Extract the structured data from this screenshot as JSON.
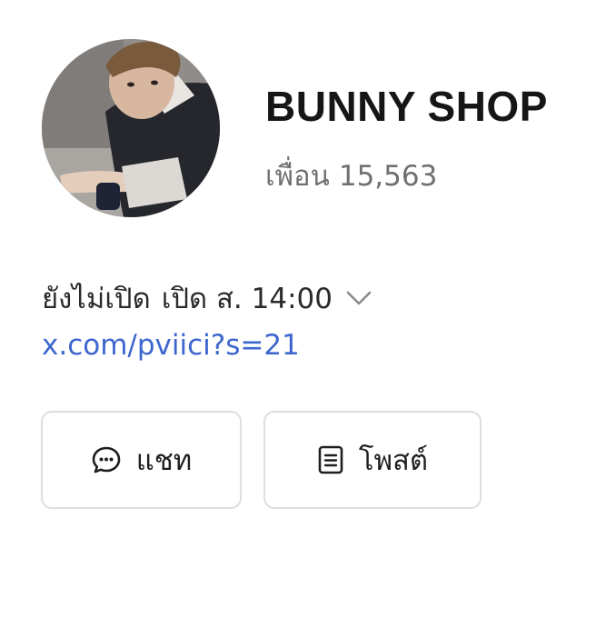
{
  "profile": {
    "name": "BUNNY SHOP",
    "friends_label": "เพื่อน",
    "friends_count": "15,563",
    "avatar_icon": "profile-photo"
  },
  "status": {
    "state": "ยังไม่เปิด",
    "opens": "เปิด ส. 14:00",
    "expand_icon": "chevron-down-icon"
  },
  "link": {
    "text": "x.com/pviici?s=21",
    "color": "#3d66ce"
  },
  "actions": [
    {
      "label": "แชท",
      "icon": "chat-bubble-icon"
    },
    {
      "label": "โพสต์",
      "icon": "post-document-icon"
    }
  ]
}
